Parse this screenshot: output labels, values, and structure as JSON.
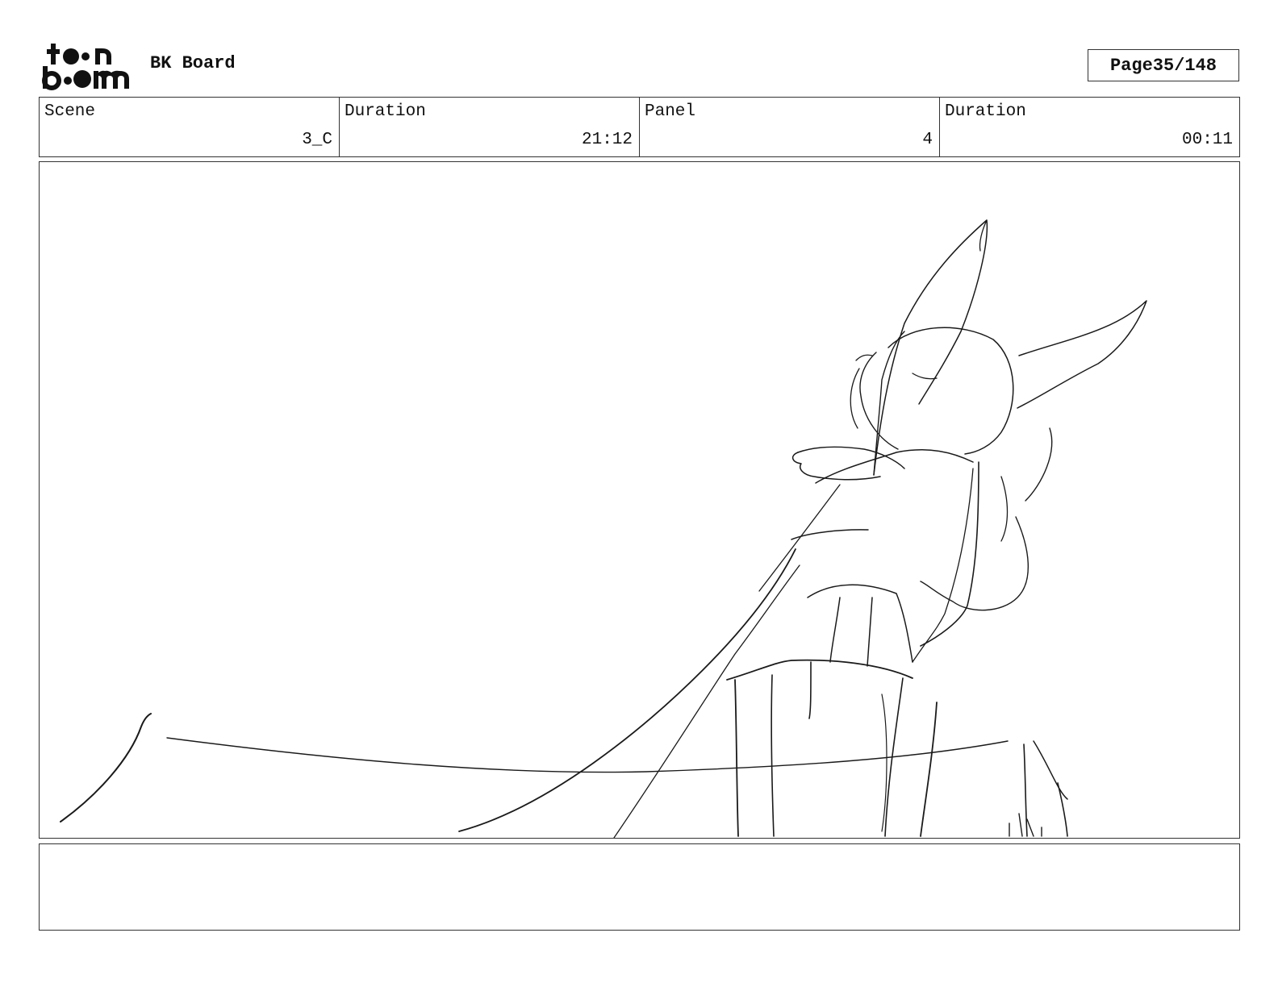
{
  "header": {
    "logo_alt": "toon boom",
    "board_title": "BK Board",
    "page_label": "Page",
    "page_value": "35/148"
  },
  "info": [
    {
      "label": "Scene",
      "value": "3_C"
    },
    {
      "label": "Duration",
      "value": "21:12"
    },
    {
      "label": "Panel",
      "value": "4"
    },
    {
      "label": "Duration",
      "value": "00:11"
    }
  ],
  "notes": {
    "text": ""
  }
}
